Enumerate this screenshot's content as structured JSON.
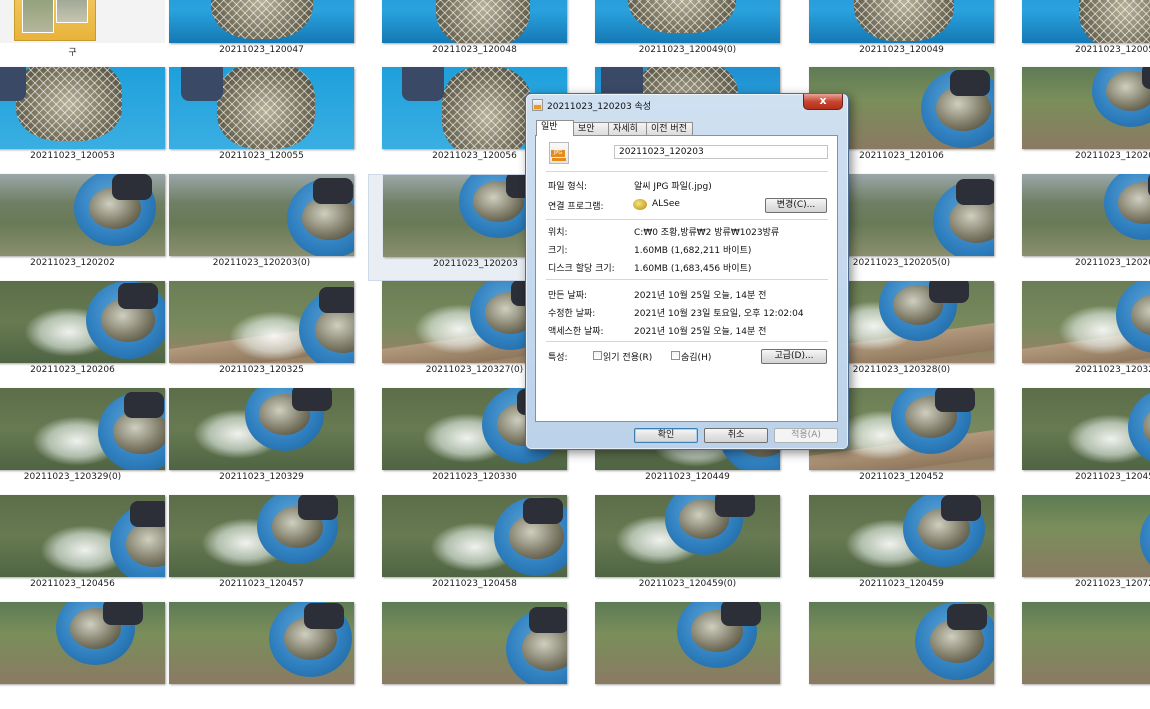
{
  "explorer": {
    "items": [
      {
        "caption": "구",
        "col": 0,
        "row": 0,
        "kind": "folder"
      },
      {
        "caption": "20211023_120047",
        "col": 1,
        "row": 0,
        "kind": "boat"
      },
      {
        "caption": "20211023_120048",
        "col": 2,
        "row": 0,
        "kind": "boat"
      },
      {
        "caption": "20211023_120049(0)",
        "col": 3,
        "row": 0,
        "kind": "boat"
      },
      {
        "caption": "20211023_120049",
        "col": 4,
        "row": 0,
        "kind": "boat"
      },
      {
        "caption": "20211023_12005",
        "col": 5,
        "row": 0,
        "kind": "boat"
      },
      {
        "caption": "20211023_120053",
        "col": 0,
        "row": 1,
        "kind": "net"
      },
      {
        "caption": "20211023_120055",
        "col": 1,
        "row": 1,
        "kind": "net"
      },
      {
        "caption": "20211023_120056",
        "col": 2,
        "row": 1,
        "kind": "net"
      },
      {
        "caption": "",
        "col": 3,
        "row": 1,
        "kind": "boat"
      },
      {
        "caption": "20211023_120106",
        "col": 4,
        "row": 1,
        "kind": "bucket"
      },
      {
        "caption": "20211023_12020",
        "col": 5,
        "row": 1,
        "kind": "bucket"
      },
      {
        "caption": "20211023_120202",
        "col": 0,
        "row": 2,
        "kind": "lake"
      },
      {
        "caption": "20211023_120203(0)",
        "col": 1,
        "row": 2,
        "kind": "lake"
      },
      {
        "caption": "20211023_120203",
        "col": 2,
        "row": 2,
        "kind": "lake",
        "selected": true
      },
      {
        "caption": "",
        "col": 3,
        "row": 2,
        "kind": "lake"
      },
      {
        "caption": "20211023_120205(0)",
        "col": 4,
        "row": 2,
        "kind": "lake"
      },
      {
        "caption": "20211023_12020",
        "col": 5,
        "row": 2,
        "kind": "lake"
      },
      {
        "caption": "20211023_120206",
        "col": 0,
        "row": 3,
        "kind": "splash"
      },
      {
        "caption": "20211023_120325",
        "col": 1,
        "row": 3,
        "kind": "dock"
      },
      {
        "caption": "20211023_120327(0)",
        "col": 2,
        "row": 3,
        "kind": "dock"
      },
      {
        "caption": "",
        "col": 3,
        "row": 3,
        "kind": "dock"
      },
      {
        "caption": "20211023_120328(0)",
        "col": 4,
        "row": 3,
        "kind": "dock"
      },
      {
        "caption": "20211023_12032",
        "col": 5,
        "row": 3,
        "kind": "dock"
      },
      {
        "caption": "20211023_120329(0)",
        "col": 0,
        "row": 4,
        "kind": "splash"
      },
      {
        "caption": "20211023_120329",
        "col": 1,
        "row": 4,
        "kind": "splash"
      },
      {
        "caption": "20211023_120330",
        "col": 2,
        "row": 4,
        "kind": "splash"
      },
      {
        "caption": "20211023_120449",
        "col": 3,
        "row": 4,
        "kind": "splash"
      },
      {
        "caption": "20211023_120452",
        "col": 4,
        "row": 4,
        "kind": "dock"
      },
      {
        "caption": "20211023_12045",
        "col": 5,
        "row": 4,
        "kind": "splash"
      },
      {
        "caption": "20211023_120456",
        "col": 0,
        "row": 5,
        "kind": "splash"
      },
      {
        "caption": "20211023_120457",
        "col": 1,
        "row": 5,
        "kind": "splash"
      },
      {
        "caption": "20211023_120458",
        "col": 2,
        "row": 5,
        "kind": "splash"
      },
      {
        "caption": "20211023_120459(0)",
        "col": 3,
        "row": 5,
        "kind": "splash"
      },
      {
        "caption": "20211023_120459",
        "col": 4,
        "row": 5,
        "kind": "splash"
      },
      {
        "caption": "20211023_12072",
        "col": 5,
        "row": 5,
        "kind": "bucket"
      },
      {
        "caption": "",
        "col": 0,
        "row": 6,
        "kind": "bucket"
      },
      {
        "caption": "",
        "col": 1,
        "row": 6,
        "kind": "bucket"
      },
      {
        "caption": "",
        "col": 2,
        "row": 6,
        "kind": "bucket"
      },
      {
        "caption": "",
        "col": 3,
        "row": 6,
        "kind": "bucket"
      },
      {
        "caption": "",
        "col": 4,
        "row": 6,
        "kind": "bucket"
      },
      {
        "caption": "",
        "col": 5,
        "row": 6,
        "kind": "bucket"
      }
    ]
  },
  "dialog": {
    "title": "20211023_120203 속성",
    "close_label": "x",
    "tabs": [
      {
        "label": "일반",
        "active": true
      },
      {
        "label": "보안"
      },
      {
        "label": "자세히"
      },
      {
        "label": "이전 버전"
      }
    ],
    "file_icon_badge": "JPG",
    "file_name": "20211023_120203",
    "file_type_label": "파일 형식:",
    "file_type_value": "알씨 JPG 파일(.jpg)",
    "open_with_label": "연결 프로그램:",
    "open_with_value": "ALSee",
    "change_button": "변경(C)...",
    "location_label": "위치:",
    "location_value": "C:₩0 조황,방류₩2 방류₩1023방류",
    "size_label": "크기:",
    "size_value": "1.60MB (1,682,211 바이트)",
    "disk_size_label": "디스크 할당 크기:",
    "disk_size_value": "1.60MB (1,683,456 바이트)",
    "created_label": "만든 날짜:",
    "created_value": "2021년 10월 25일 오늘, 14분 전",
    "modified_label": "수정한 날짜:",
    "modified_value": "2021년 10월 23일 토요일, 오후 12:02:04",
    "accessed_label": "액세스한 날짜:",
    "accessed_value": "2021년 10월 25일 오늘, 14분 전",
    "attributes_label": "특성:",
    "readonly_label": "읽기 전용(R)",
    "hidden_label": "숨김(H)",
    "advanced_button": "고급(D)...",
    "ok_button": "확인",
    "cancel_button": "취소",
    "apply_button": "적용(A)"
  },
  "colors": {
    "bucket_blue": "#2f7fbf",
    "dialog_frame": "#bcd2ea",
    "close_red": "#c8462f",
    "jpg_orange": "#e38b1d"
  }
}
